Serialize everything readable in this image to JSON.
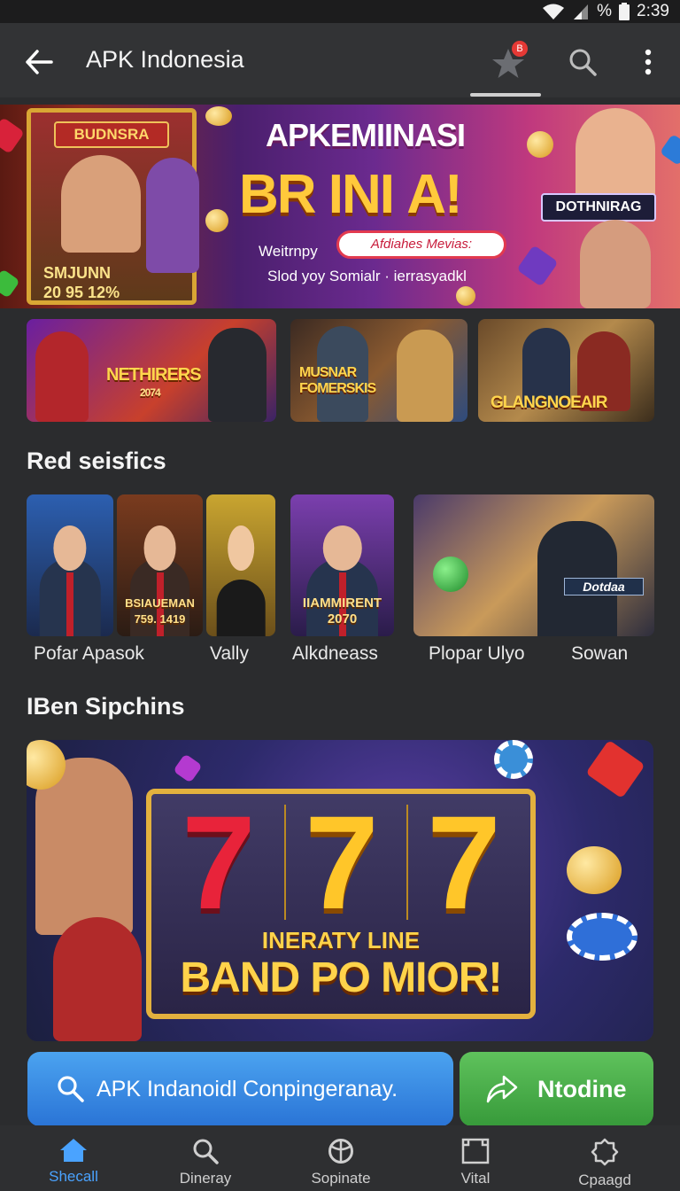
{
  "status_bar": {
    "battery": "%",
    "time": "2:39"
  },
  "app_bar": {
    "title": "APK Indonesia",
    "badge": "B"
  },
  "hero": {
    "frame_title": "BUDNSRA",
    "frame_bottom_1": "SMJUNN",
    "frame_bottom_2": "20 95 12%",
    "headline": "APKEMIINASI",
    "brand": "BR INI A!",
    "line1": "Weitrnpy",
    "pill": "Afdiahes Mevias:",
    "line2": "Slod yoy Somialr · ierrasyadkl",
    "right_label": "DOTHNIRAG"
  },
  "promos": [
    {
      "label": "NETHIRERS",
      "sub": "2074"
    },
    {
      "label": "MUSNAR\nFOMERSKIS",
      "sub": ""
    },
    {
      "label": "GLANGNOEAIR",
      "sub": ""
    }
  ],
  "section1": {
    "title": "Red seisfics"
  },
  "games": [
    {
      "tag": "",
      "caption": "Pofar Apasok"
    },
    {
      "tag": "BSIAUEMAN\n759. 1419",
      "caption": ""
    },
    {
      "tag": "",
      "caption": "Vally"
    },
    {
      "tag": "IIAMMIRENT\n2070",
      "caption": "Alkdneass"
    },
    {
      "tag": "Dotdaa",
      "caption": "Plopar Ulyo"
    },
    {
      "tag": "",
      "caption": "Sowan"
    }
  ],
  "section2": {
    "title": "IBen Sipchins"
  },
  "featured": {
    "reels": [
      "7",
      "7",
      "7"
    ],
    "subtitle": "INERATY LINE",
    "title": "BAND PO MIOR!"
  },
  "actions": {
    "primary_label": "APK Indanoidl Conpingeranay.",
    "secondary_label": "Ntodine"
  },
  "nav": [
    {
      "label": "Shecall",
      "icon": "home-icon",
      "active": true
    },
    {
      "label": "Dineray",
      "icon": "search-icon",
      "active": false
    },
    {
      "label": "Sopinate",
      "icon": "globe-icon",
      "active": false
    },
    {
      "label": "Vital",
      "icon": "frame-icon",
      "active": false
    },
    {
      "label": "Cpaagd",
      "icon": "settings-icon",
      "active": false
    }
  ],
  "colors": {
    "background": "#2b2c2e",
    "primary_button": "#2f80e0",
    "secondary_button": "#47ad48",
    "active_nav": "#4aa3ff",
    "badge": "#e53935"
  }
}
